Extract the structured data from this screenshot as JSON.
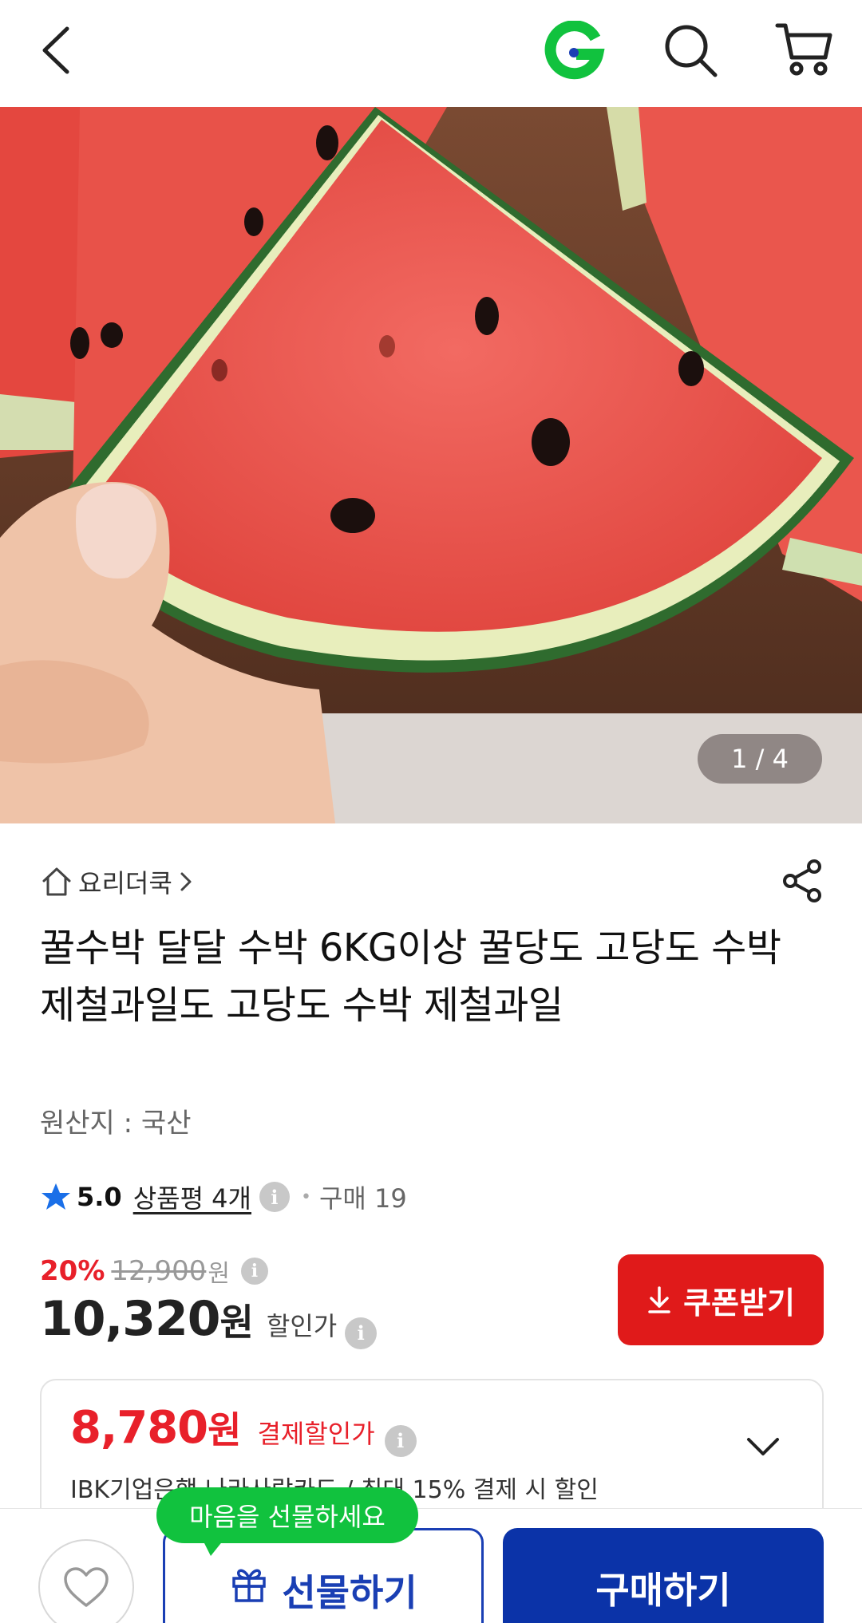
{
  "header": {
    "back_icon": "chevron-left-icon",
    "logo_icon": "gmarket-g-logo",
    "search_icon": "search-icon",
    "cart_icon": "cart-icon"
  },
  "gallery": {
    "counter": "1 / 4"
  },
  "store": {
    "name": "요리더쿡",
    "home_icon": "home-icon"
  },
  "product": {
    "title": "꿀수박 달달 수박 6KG이상 꿀당도 고당도 수박 제철과일도 고당도 수박 제철과일",
    "origin": "원산지 : 국산"
  },
  "rating": {
    "score": "5.0",
    "reviews": "상품평 4개",
    "purchases": "구매 19"
  },
  "price": {
    "discount_rate": "20%",
    "original": "12,900",
    "original_unit": "원",
    "sale": "10,320",
    "sale_unit": "원",
    "sale_label": "할인가"
  },
  "coupon": {
    "label": "쿠폰받기"
  },
  "payment_discount": {
    "price": "8,780",
    "unit": "원",
    "label": "결제할인가",
    "description": "IBK기업은행 나라사랑카드 / 최대 15% 결제 시 할인"
  },
  "bottom": {
    "gift_tooltip": "마음을 선물하세요",
    "gift_label": "선물하기",
    "buy_label": "구매하기"
  },
  "colors": {
    "accent_red": "#e01a1a",
    "brand_blue": "#0b33a8",
    "brand_green": "#11c23e",
    "star_blue": "#1a6fe8"
  }
}
